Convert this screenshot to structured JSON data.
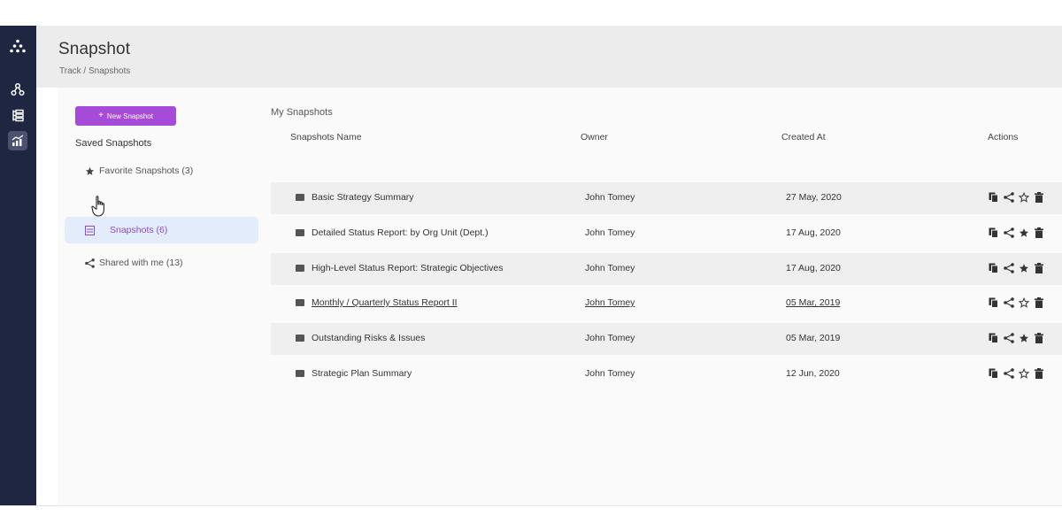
{
  "app": {
    "title": "Snapshot",
    "breadcrumb": "Track / Snapshots"
  },
  "rail": {
    "icons": [
      "logo-icon",
      "network-icon",
      "list-tree-icon",
      "chart-trend-icon"
    ],
    "active": "chart-trend-icon"
  },
  "sidebar": {
    "new_button_label": "New Snapshot",
    "saved_title": "Saved Snapshots",
    "items": [
      {
        "label": "Favorite Snapshots (3)",
        "icon": "star-icon"
      },
      {
        "label": "Snapshots (6)",
        "icon": "snapshot-icon"
      },
      {
        "label": "Shared with me (13)",
        "icon": "share-icon"
      }
    ]
  },
  "main": {
    "section_title": "My Snapshots",
    "columns": {
      "name": "Snapshots Name",
      "owner": "Owner",
      "created": "Created At",
      "actions": "Actions"
    },
    "rows": [
      {
        "name": "Basic Strategy Summary",
        "owner": "John Tomey",
        "created": "27 May, 2020",
        "favorite": false
      },
      {
        "name": "Detailed Status Report: by Org Unit (Dept.)",
        "owner": "John Tomey",
        "created": "17 Aug, 2020",
        "favorite": true
      },
      {
        "name": "High-Level Status Report: Strategic Objectives",
        "owner": "John Tomey",
        "created": "17 Aug, 2020",
        "favorite": true
      },
      {
        "name": "Monthly / Quarterly Status Report II",
        "owner": "John Tomey",
        "created": "05 Mar, 2019",
        "favorite": false
      },
      {
        "name": "Outstanding Risks & Issues",
        "owner": "John Tomey",
        "created": "05 Mar, 2019",
        "favorite": true
      },
      {
        "name": "Strategic Plan Summary",
        "owner": "John Tomey",
        "created": "12 Jun, 2020",
        "favorite": false
      }
    ]
  },
  "colors": {
    "rail": "#1e2642",
    "accent": "#a64ad8",
    "active_item_bg": "#e3ecfa"
  }
}
